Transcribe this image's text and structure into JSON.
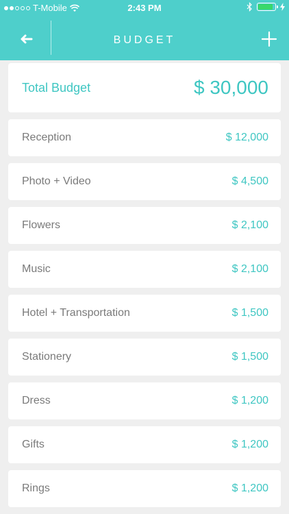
{
  "status_bar": {
    "carrier": "T-Mobile",
    "time": "2:43 PM",
    "signal_dots_full": 2,
    "signal_dots_total": 5,
    "battery_level": 0.9
  },
  "header": {
    "title": "BUDGET"
  },
  "total": {
    "label": "Total Budget",
    "value": "$ 30,000"
  },
  "items": [
    {
      "label": "Reception",
      "value": "$ 12,000"
    },
    {
      "label": "Photo + Video",
      "value": "$ 4,500"
    },
    {
      "label": "Flowers",
      "value": "$ 2,100"
    },
    {
      "label": "Music",
      "value": "$ 2,100"
    },
    {
      "label": "Hotel + Transportation",
      "value": "$ 1,500"
    },
    {
      "label": "Stationery",
      "value": "$ 1,500"
    },
    {
      "label": "Dress",
      "value": "$ 1,200"
    },
    {
      "label": "Gifts",
      "value": "$ 1,200"
    },
    {
      "label": "Rings",
      "value": "$ 1,200"
    }
  ],
  "colors": {
    "accent": "#4ecfcb",
    "accent_text": "#3ec6c2",
    "label_text": "#7a7a7a",
    "background": "#efefef"
  }
}
